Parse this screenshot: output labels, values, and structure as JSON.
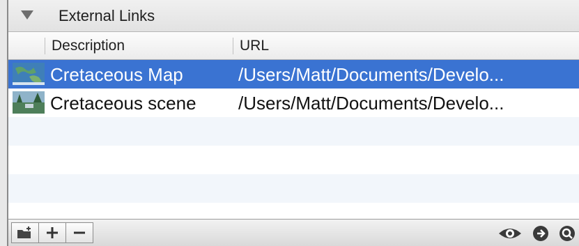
{
  "section": {
    "title": "External Links",
    "disclosure_icon": "triangle-down-icon"
  },
  "columns": {
    "description": "Description",
    "url": "URL"
  },
  "rows": [
    {
      "description": "Cretaceous Map",
      "url": "/Users/Matt/Documents/Develo...",
      "selected": true,
      "thumbnail_icon": "map-thumbnail-icon"
    },
    {
      "description": "Cretaceous scene",
      "url": "/Users/Matt/Documents/Develo...",
      "selected": false,
      "thumbnail_icon": "scene-thumbnail-icon"
    }
  ],
  "toolbar": {
    "left_buttons": [
      "add-folder-icon",
      "plus-icon",
      "minus-icon"
    ],
    "right_icons": [
      "eye-icon",
      "go-arrow-icon",
      "magnifier-icon"
    ]
  },
  "colors": {
    "selection": "#3a73d2",
    "alt_row": "#f2f6fb"
  }
}
